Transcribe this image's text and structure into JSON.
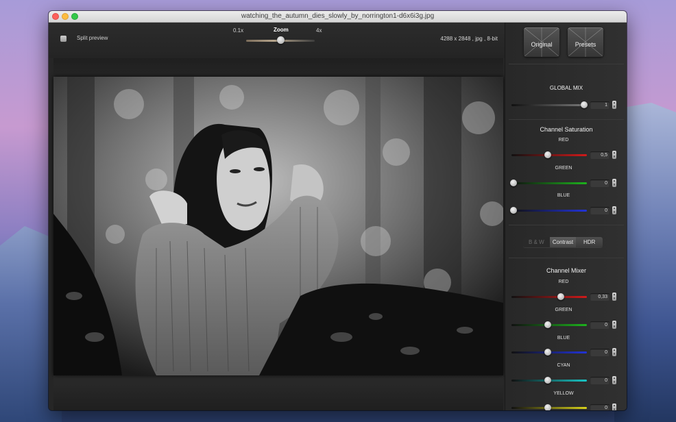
{
  "window": {
    "title": "watching_the_autumn_dies_slowly_by_norrington1-d6x6i3g.jpg"
  },
  "toolbar": {
    "split_preview_label": "Split preview",
    "zoom_label": "Zoom",
    "zoom_min": "0.1x",
    "zoom_max": "4x",
    "image_info": "4288 x 2848 , jpg , 8-bit"
  },
  "sidebar": {
    "original_label": "Original",
    "presets_label": "Presets",
    "global_mix": {
      "title": "GLOBAL MIX",
      "value": "1"
    },
    "channel_saturation": {
      "title": "Channel Saturation",
      "channels": [
        {
          "label": "RED",
          "value": "0,5",
          "color": "#d11a1a"
        },
        {
          "label": "GREEN",
          "value": "0",
          "color": "#1db31d"
        },
        {
          "label": "BLUE",
          "value": "0",
          "color": "#2233d6"
        }
      ]
    },
    "mode_tabs": [
      "B & W",
      "Contrast",
      "HDR"
    ],
    "channel_mixer": {
      "title": "Channel Mixer",
      "channels": [
        {
          "label": "RED",
          "value": "0,33",
          "color": "#d11a1a"
        },
        {
          "label": "GREEN",
          "value": "0",
          "color": "#1db31d"
        },
        {
          "label": "BLUE",
          "value": "0",
          "color": "#2233d6"
        },
        {
          "label": "CYAN",
          "value": "0",
          "color": "#19c4c4"
        },
        {
          "label": "YELLOW",
          "value": "0",
          "color": "#d8d21a"
        }
      ]
    }
  }
}
